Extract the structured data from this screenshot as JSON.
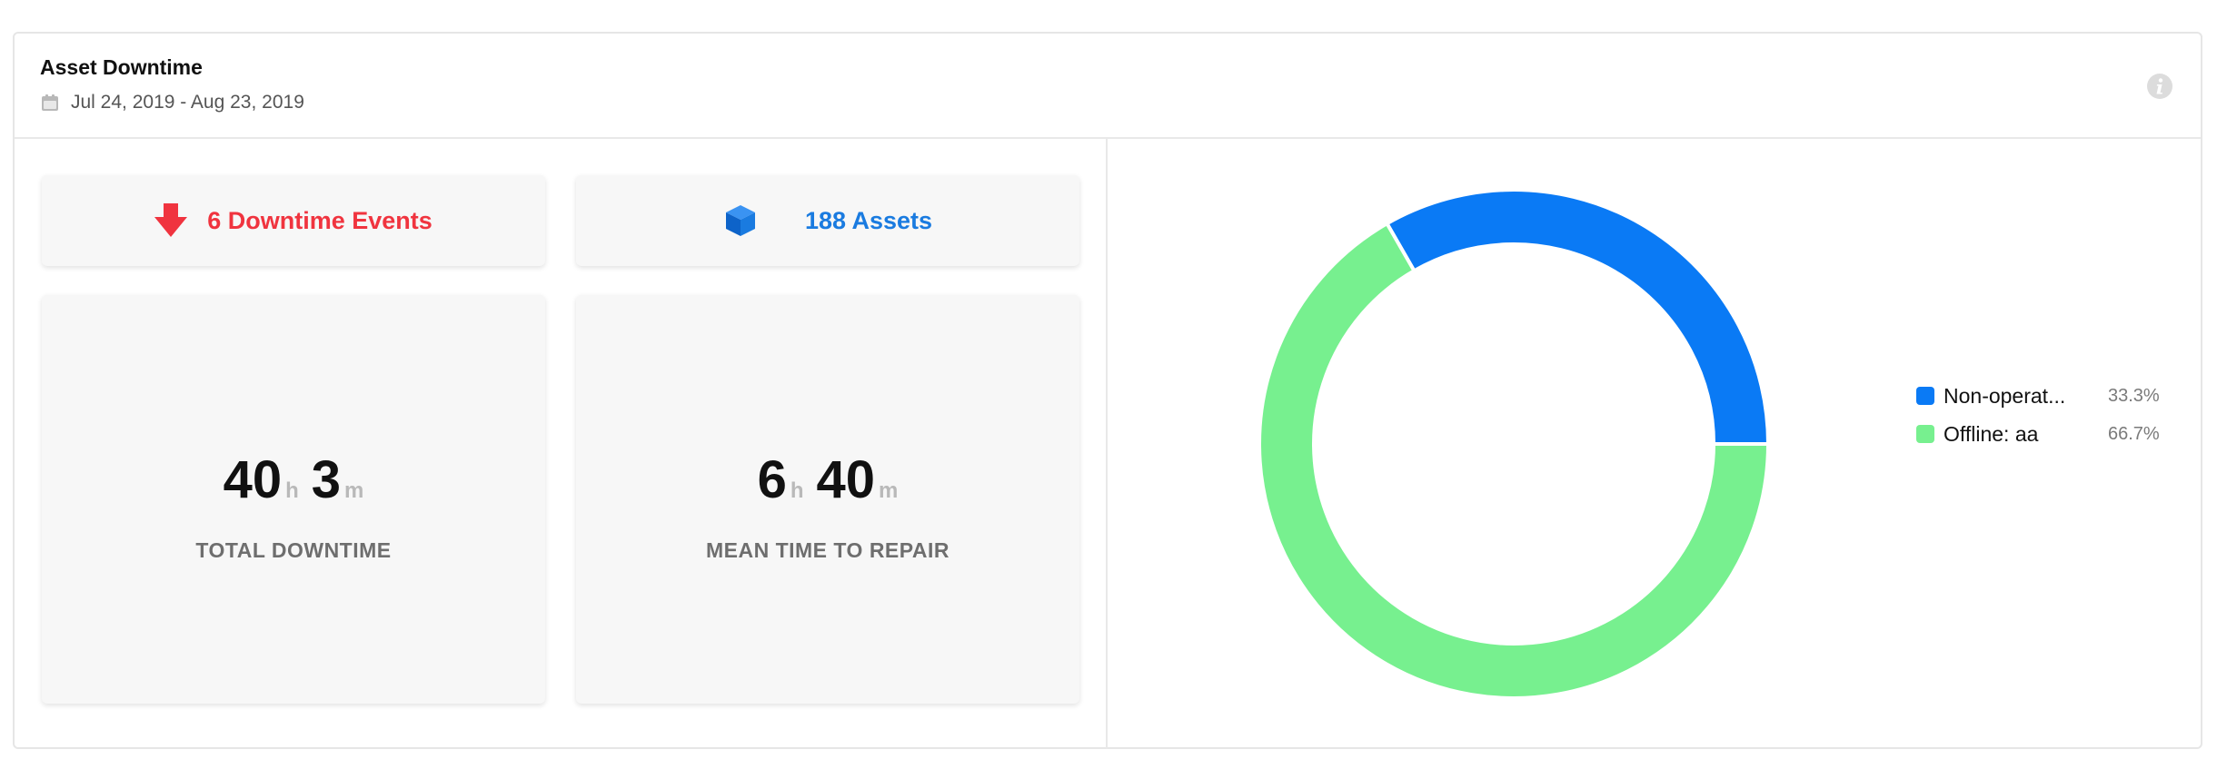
{
  "widget": {
    "title": "Asset Downtime",
    "date_range": "Jul 24, 2019 - Aug 23, 2019",
    "icons": {
      "calendar": "calendar-icon",
      "info": "info-icon"
    }
  },
  "summary": {
    "events_label": "6 Downtime Events",
    "events_icon": "arrow-down-icon",
    "events_color": "#f0343f",
    "assets_label": "188 Assets",
    "assets_icon": "cube-icon",
    "assets_color": "#1a7be0"
  },
  "metrics": {
    "total_downtime": {
      "hours": "40",
      "hours_unit": "h",
      "minutes": "3",
      "minutes_unit": "m",
      "label": "TOTAL DOWNTIME"
    },
    "mttr": {
      "hours": "6",
      "hours_unit": "h",
      "minutes": "40",
      "minutes_unit": "m",
      "label": "MEAN TIME TO REPAIR"
    }
  },
  "chart_data": {
    "type": "pie",
    "donut": true,
    "legend_position": "right",
    "series": [
      {
        "name": "Non-operat...",
        "value": 33.3,
        "label": "33.3%",
        "color": "#0a7af5"
      },
      {
        "name": "Offline: aa",
        "value": 66.7,
        "label": "66.7%",
        "color": "#77f08f"
      }
    ]
  }
}
